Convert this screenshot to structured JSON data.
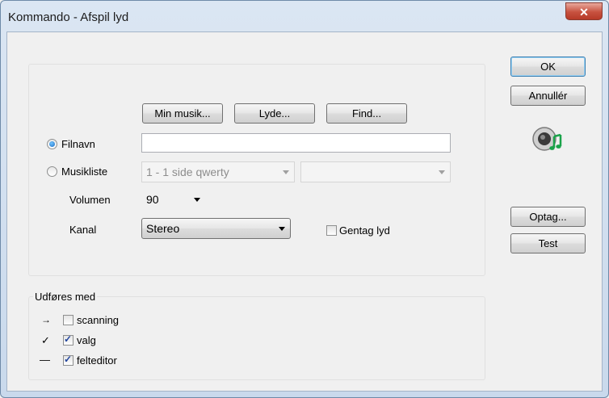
{
  "window": {
    "title": "Kommando - Afspil lyd",
    "close_glyph": "✕"
  },
  "top_buttons": {
    "my_music": "Min musik...",
    "sounds": "Lyde...",
    "find": "Find..."
  },
  "filename": {
    "label": "Filnavn",
    "value": "",
    "selected": true
  },
  "music_list": {
    "label": "Musikliste",
    "selected": false,
    "first_value": "1 - 1 side qwerty",
    "second_value": ""
  },
  "volume": {
    "label": "Volumen",
    "value": "90"
  },
  "channel": {
    "label": "Kanal",
    "value": "Stereo"
  },
  "repeat": {
    "label": "Gentag lyd",
    "checked": false
  },
  "executed_with": {
    "legend": "Udføres med",
    "items": [
      {
        "symbol": "→",
        "label": "scanning",
        "checked": false
      },
      {
        "symbol": "✓",
        "label": "valg",
        "checked": true
      },
      {
        "symbol": "—",
        "label": "felteditor",
        "checked": true
      }
    ]
  },
  "side_buttons": {
    "ok": "OK",
    "cancel": "Annullér",
    "record": "Optag...",
    "test": "Test"
  },
  "icons": {
    "sound": "speaker-music-note-icon"
  },
  "colors": {
    "accent_green": "#1aa34a",
    "close_red": "#c7513f"
  }
}
